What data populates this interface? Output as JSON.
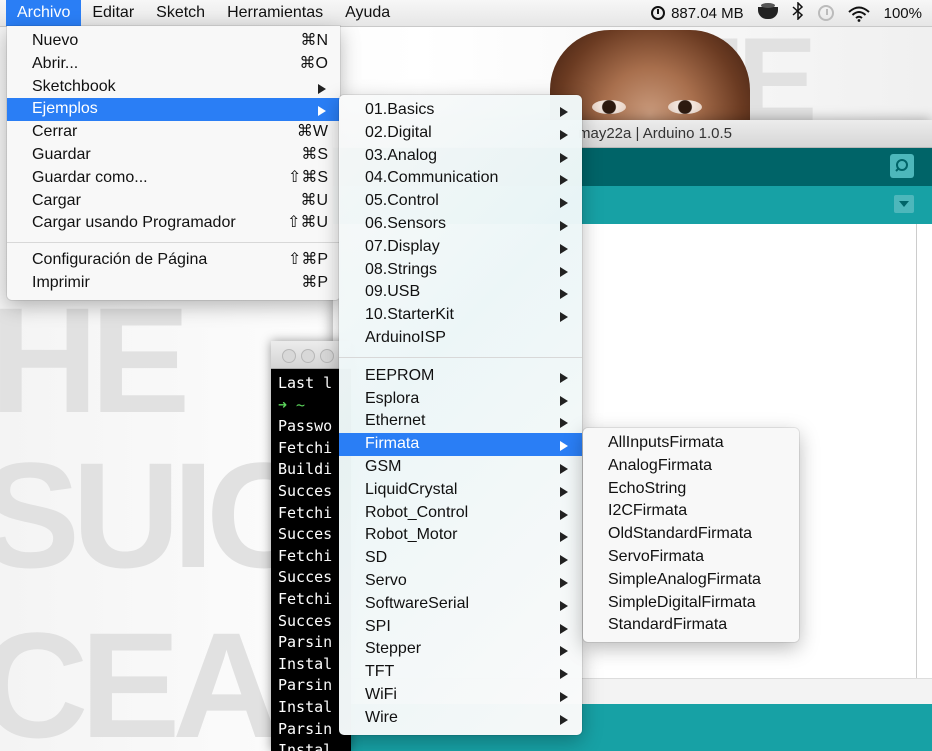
{
  "menubar": {
    "items": [
      "Archivo",
      "Editar",
      "Sketch",
      "Herramientas",
      "Ayuda"
    ],
    "active_index": 0,
    "memory": "887.04 MB",
    "battery": "100%"
  },
  "archivo_menu": {
    "group1": [
      {
        "label": "Nuevo",
        "shortcut": "⌘N"
      },
      {
        "label": "Abrir...",
        "shortcut": "⌘O"
      },
      {
        "label": "Sketchbook",
        "submenu": true
      },
      {
        "label": "Ejemplos",
        "submenu": true,
        "selected": true
      },
      {
        "label": "Cerrar",
        "shortcut": "⌘W"
      },
      {
        "label": "Guardar",
        "shortcut": "⌘S"
      },
      {
        "label": "Guardar como...",
        "shortcut": "⇧⌘S"
      },
      {
        "label": "Cargar",
        "shortcut": "⌘U"
      },
      {
        "label": "Cargar usando Programador",
        "shortcut": "⇧⌘U"
      }
    ],
    "group2": [
      {
        "label": "Configuración de Página",
        "shortcut": "⇧⌘P"
      },
      {
        "label": "Imprimir",
        "shortcut": "⌘P"
      }
    ]
  },
  "ejemplos_menu": {
    "builtin": [
      {
        "label": "01.Basics",
        "submenu": true
      },
      {
        "label": "02.Digital",
        "submenu": true
      },
      {
        "label": "03.Analog",
        "submenu": true
      },
      {
        "label": "04.Communication",
        "submenu": true
      },
      {
        "label": "05.Control",
        "submenu": true
      },
      {
        "label": "06.Sensors",
        "submenu": true
      },
      {
        "label": "07.Display",
        "submenu": true
      },
      {
        "label": "08.Strings",
        "submenu": true
      },
      {
        "label": "09.USB",
        "submenu": true
      },
      {
        "label": "10.StarterKit",
        "submenu": true
      },
      {
        "label": "ArduinoISP",
        "submenu": false
      }
    ],
    "libraries": [
      {
        "label": "EEPROM",
        "submenu": true
      },
      {
        "label": "Esplora",
        "submenu": true
      },
      {
        "label": "Ethernet",
        "submenu": true
      },
      {
        "label": "Firmata",
        "submenu": true,
        "selected": true
      },
      {
        "label": "GSM",
        "submenu": true
      },
      {
        "label": "LiquidCrystal",
        "submenu": true
      },
      {
        "label": "Robot_Control",
        "submenu": true
      },
      {
        "label": "Robot_Motor",
        "submenu": true
      },
      {
        "label": "SD",
        "submenu": true
      },
      {
        "label": "Servo",
        "submenu": true
      },
      {
        "label": "SoftwareSerial",
        "submenu": true
      },
      {
        "label": "SPI",
        "submenu": true
      },
      {
        "label": "Stepper",
        "submenu": true
      },
      {
        "label": "TFT",
        "submenu": true
      },
      {
        "label": "WiFi",
        "submenu": true
      },
      {
        "label": "Wire",
        "submenu": true
      }
    ]
  },
  "firmata_menu": {
    "items": [
      "AllInputsFirmata",
      "AnalogFirmata",
      "EchoString",
      "I2CFirmata",
      "OldStandardFirmata",
      "ServoFirmata",
      "SimpleAnalogFirmata",
      "SimpleDigitalFirmata",
      "StandardFirmata"
    ]
  },
  "arduino_window": {
    "title": "may22a | Arduino 1.0.5"
  },
  "terminal": {
    "lines": [
      "Last l",
      "➜ ~",
      "Passwo",
      "Fetchi",
      "Buildi",
      "Succes",
      "Fetchi",
      "Succes",
      "Fetchi",
      "Succes",
      "Fetchi",
      "Succes",
      "Parsin",
      "Instal",
      "Parsin",
      "Instal",
      "Parsin",
      "Instal"
    ]
  },
  "colors": {
    "menu_highlight": "#2a7ef5",
    "arduino_dark_teal": "#006468",
    "arduino_teal": "#17a1a5"
  }
}
